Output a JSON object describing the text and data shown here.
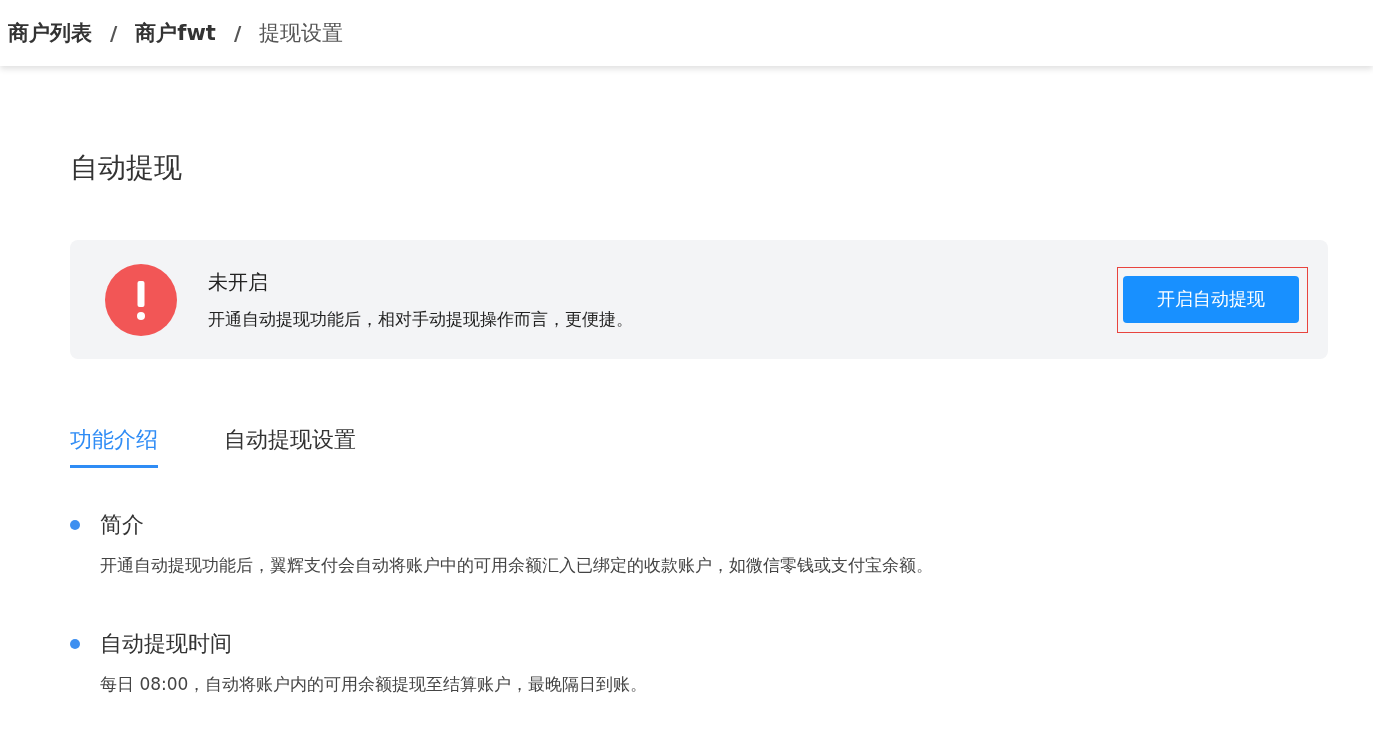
{
  "breadcrumb_separator": "/",
  "breadcrumb": [
    {
      "label": "商户列表",
      "current": false
    },
    {
      "label": "商户fwt",
      "current": false
    },
    {
      "label": "提现设置",
      "current": true
    }
  ],
  "page_title": "自动提现",
  "alert": {
    "kind": "error",
    "title": "未开启",
    "description": "开通自动提现功能后，相对手动提现操作而言，更便捷。",
    "button": "开启自动提现",
    "highlighted": true
  },
  "tabs": [
    {
      "label": "功能介绍",
      "selected": true
    },
    {
      "label": "自动提现设置",
      "selected": false
    }
  ],
  "sections": [
    {
      "title": "简介",
      "description": "开通自动提现功能后，翼辉支付会自动将账户中的可用余额汇入已绑定的收款账户，如微信零钱或支付宝余额。"
    },
    {
      "title": "自动提现时间",
      "description": "每日 08:00，自动将账户内的可用余额提现至结算账户，最晚隔日到账。"
    }
  ]
}
